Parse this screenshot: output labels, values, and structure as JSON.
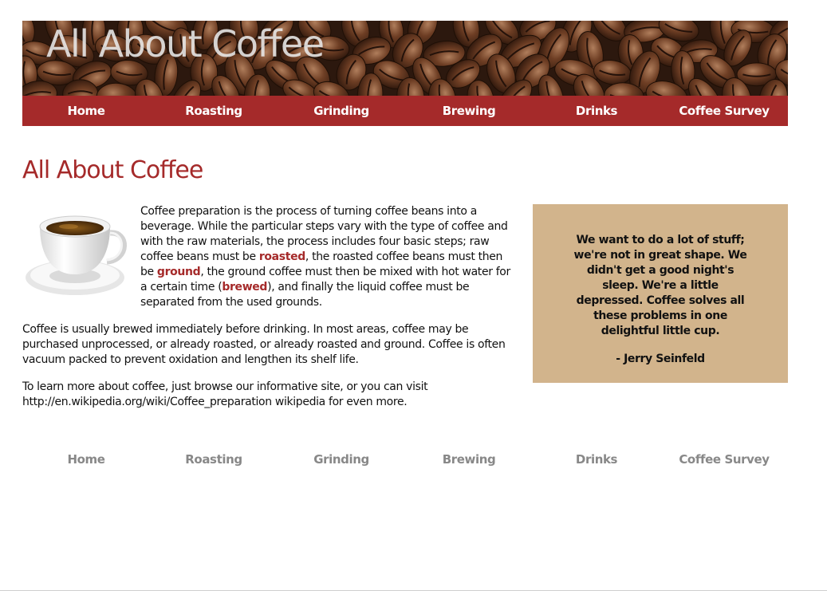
{
  "banner": {
    "title": "All About Coffee"
  },
  "nav": {
    "items": [
      {
        "label": "Home"
      },
      {
        "label": "Roasting"
      },
      {
        "label": "Grinding"
      },
      {
        "label": "Brewing"
      },
      {
        "label": "Drinks"
      },
      {
        "label": "Coffee Survey"
      }
    ]
  },
  "page": {
    "title": "All About Coffee",
    "intro": {
      "t1": "Coffee preparation is the process of turning coffee beans into a beverage. While the particular steps vary with the type of coffee and with the raw materials, the process includes four basic steps; raw coffee beans must be ",
      "k1": "roasted",
      "t2": ", the roasted coffee beans must then be ",
      "k2": "ground",
      "t3": ", the ground coffee must then be mixed with hot water for a certain time (",
      "k3": "brewed",
      "t4": "), and finally the liquid coffee must be separated from the used grounds."
    },
    "para2": "Coffee is usually brewed immediately before drinking. In most areas, coffee may be purchased unprocessed, or already roasted, or already roasted and ground. Coffee is often vacuum packed to prevent oxidation and lengthen its shelf life.",
    "para3_text": "To learn more about coffee, just browse our informative site, or you can visit http://en.wikipedia.org/wiki/Coffee_preparation wikipedia for even more."
  },
  "quote": {
    "text": "We want to do a lot of stuff; we're not in great shape. We didn't get a good night's sleep. We're a little depressed. Coffee solves all these problems in one delightful little cup.",
    "author": "- Jerry Seinfeld"
  },
  "colors": {
    "accent": "#a52a2a",
    "quote_bg": "#d2b48c",
    "footer_link": "#888888"
  },
  "icons": {
    "banner_image": "coffee-beans-image",
    "cup_image": "coffee-cup-image"
  }
}
